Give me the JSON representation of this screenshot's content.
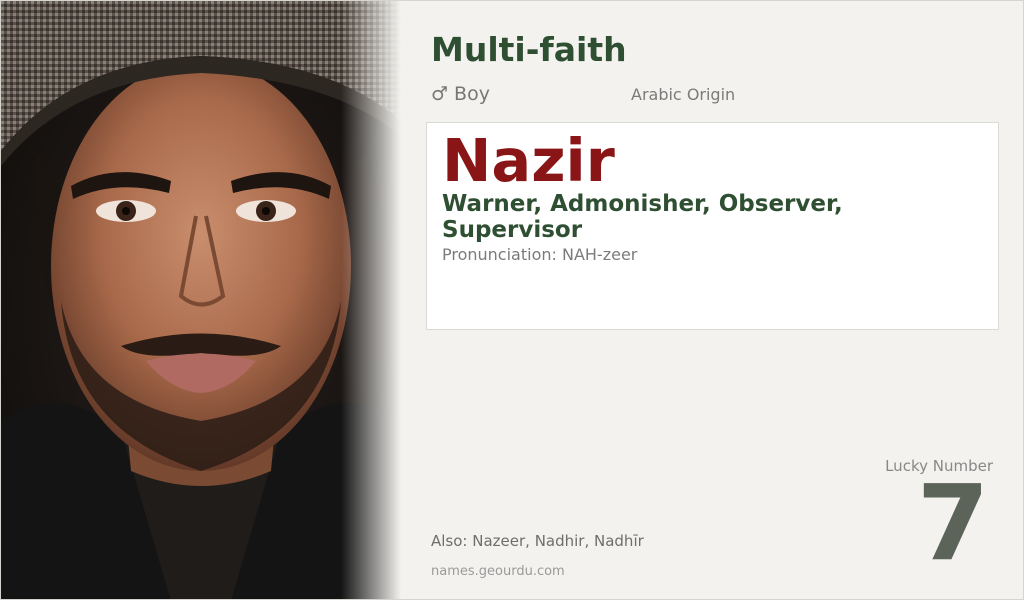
{
  "category": "Multi-faith",
  "gender": {
    "icon": "male-symbol-icon",
    "symbol": "♂",
    "label": "Boy"
  },
  "origin": "Arabic Origin",
  "name": "Nazir",
  "meaning": "Warner, Admonisher, Observer, Supervisor",
  "pronunciation": "Pronunciation: NAH-zeer",
  "lucky": {
    "label": "Lucky Number",
    "number": "7"
  },
  "also": "Also: Nazeer, Nadhir, Nadhīr",
  "site": "names.geourdu.com",
  "colors": {
    "accent_green": "#2f4f32",
    "name_red": "#8a1516",
    "background": "#f3f2ef"
  }
}
